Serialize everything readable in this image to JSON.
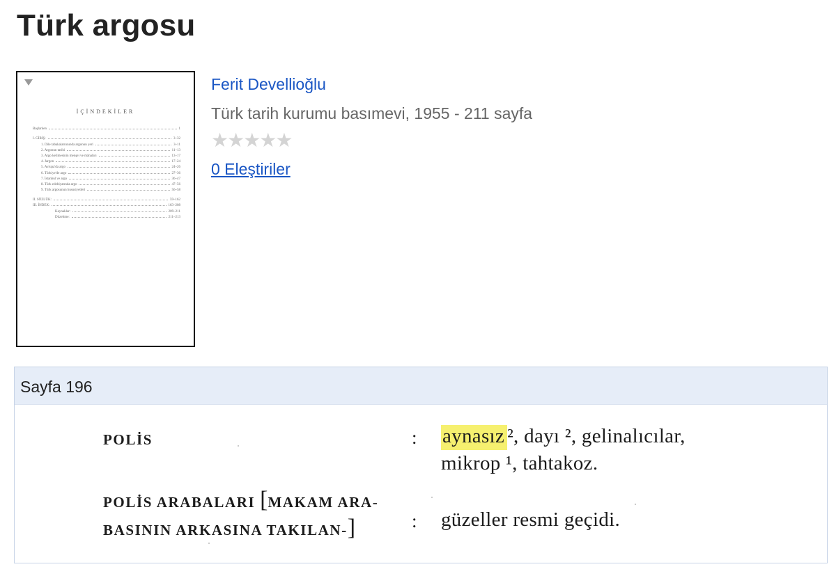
{
  "book": {
    "title": "Türk argosu",
    "author": "Ferit Devellioğlu",
    "publisher_line": "Türk tarih kurumu basımevi, 1955 - 211 sayfa",
    "rating_stars": "★★★★★",
    "rating_value": 0,
    "reviews_link": "0 Eleştiriler"
  },
  "cover": {
    "heading": "İÇİNDEKİLER",
    "toc": [
      {
        "label": "Başlarken",
        "page": "1"
      },
      {
        "label": "I. GİRİŞ:",
        "page": "3–32"
      },
      {
        "label": "1. Dile tabakalarınnında argonun yeri",
        "page": "3–11"
      },
      {
        "label": "2. Argonun tarihi",
        "page": "11–13"
      },
      {
        "label": "3. Argo kelimesinin menşei ve mânaları",
        "page": "13–17"
      },
      {
        "label": "4. Jargon",
        "page": "17–24"
      },
      {
        "label": "5. Avrupa'da argo",
        "page": "24–26"
      },
      {
        "label": "6. Türkiye'de argo",
        "page": "27–36"
      },
      {
        "label": "7. İstanbul ve argo",
        "page": "36–47"
      },
      {
        "label": "8. Türk edebiyatında argo",
        "page": "47–56"
      },
      {
        "label": "9. Türk argosunun hususiyetleri",
        "page": "56–58"
      },
      {
        "label": "II. SÖZLÜK:",
        "page": "59–162"
      },
      {
        "label": "III. İNDEX:",
        "page": "163–208"
      },
      {
        "label": "Kaynaklar:",
        "page": "209–211"
      },
      {
        "label": "Düzeltme:",
        "page": "211–213"
      }
    ]
  },
  "snippet": {
    "page_label": "Sayfa 196",
    "lines": {
      "entry1_term": "POLİS",
      "entry1_colon": ":",
      "entry1_highlight": "aynasız",
      "entry1_rest": "², dayı ², gelinalıcılar,",
      "entry1_cont": "mikrop ¹, tahtakoz.",
      "entry2_term_a": "POLİS ARABALARI",
      "entry2_bracket_open": "[",
      "entry2_term_b": "MAKAM ARA-",
      "entry2_term_c": "BASININ ARKASINA TAKILAN-",
      "entry2_bracket_close": "]",
      "entry2_colon": ":",
      "entry2_def": "güzeller resmi geçidi."
    }
  },
  "colors": {
    "link": "#1a56c4",
    "highlight": "#f6f06f",
    "snippet_header_bg": "#e6edf8",
    "star_empty": "#d4d4d4"
  }
}
